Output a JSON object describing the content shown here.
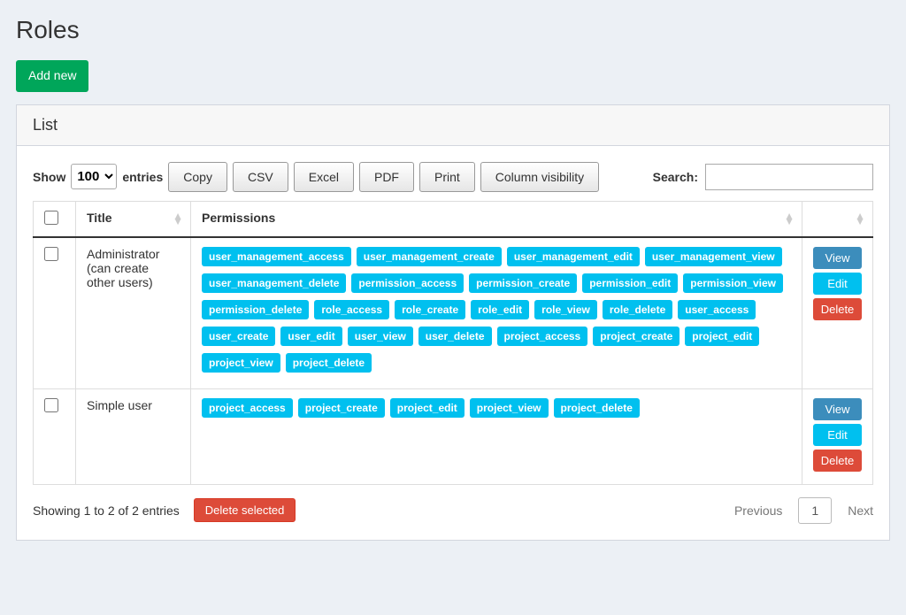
{
  "page": {
    "title": "Roles"
  },
  "buttons": {
    "add_new": "Add new",
    "copy": "Copy",
    "csv": "CSV",
    "excel": "Excel",
    "pdf": "PDF",
    "print": "Print",
    "colvis": "Column visibility",
    "delete_selected": "Delete selected"
  },
  "panel": {
    "header": "List"
  },
  "length": {
    "show": "Show",
    "entries": "entries",
    "value": "100"
  },
  "search": {
    "label": "Search:",
    "value": ""
  },
  "columns": {
    "title": "Title",
    "permissions": "Permissions"
  },
  "rows": [
    {
      "title": "Administrator (can create other users)",
      "permissions": [
        "user_management_access",
        "user_management_create",
        "user_management_edit",
        "user_management_view",
        "user_management_delete",
        "permission_access",
        "permission_create",
        "permission_edit",
        "permission_view",
        "permission_delete",
        "role_access",
        "role_create",
        "role_edit",
        "role_view",
        "role_delete",
        "user_access",
        "user_create",
        "user_edit",
        "user_view",
        "user_delete",
        "project_access",
        "project_create",
        "project_edit",
        "project_view",
        "project_delete"
      ]
    },
    {
      "title": "Simple user",
      "permissions": [
        "project_access",
        "project_create",
        "project_edit",
        "project_view",
        "project_delete"
      ]
    }
  ],
  "actions": {
    "view": "View",
    "edit": "Edit",
    "delete": "Delete"
  },
  "info": "Showing 1 to 2 of 2 entries",
  "pager": {
    "previous": "Previous",
    "page": "1",
    "next": "Next"
  }
}
